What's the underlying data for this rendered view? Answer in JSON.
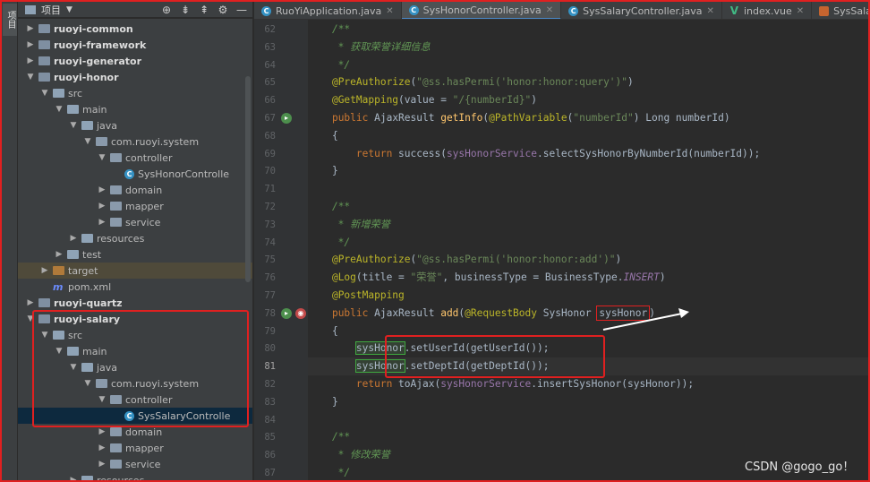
{
  "sidebar": {
    "vertical_tab": "项目"
  },
  "project_panel": {
    "header_label": "项目",
    "tree": [
      {
        "label": "ruoyi-common",
        "type": "module",
        "arrow": "▶",
        "indent": 1,
        "bold": true
      },
      {
        "label": "ruoyi-framework",
        "type": "module",
        "arrow": "▶",
        "indent": 1,
        "bold": true
      },
      {
        "label": "ruoyi-generator",
        "type": "module",
        "arrow": "▶",
        "indent": 1,
        "bold": true
      },
      {
        "label": "ruoyi-honor",
        "type": "module",
        "arrow": "▼",
        "indent": 1,
        "bold": true
      },
      {
        "label": "src",
        "type": "folder",
        "arrow": "▼",
        "indent": 2
      },
      {
        "label": "main",
        "type": "folder",
        "arrow": "▼",
        "indent": 3
      },
      {
        "label": "java",
        "type": "folder",
        "arrow": "▼",
        "indent": 4
      },
      {
        "label": "com.ruoyi.system",
        "type": "package",
        "arrow": "▼",
        "indent": 5
      },
      {
        "label": "controller",
        "type": "package",
        "arrow": "▼",
        "indent": 6
      },
      {
        "label": "SysHonorControlle",
        "type": "class",
        "arrow": "",
        "indent": 7
      },
      {
        "label": "domain",
        "type": "package",
        "arrow": "▶",
        "indent": 6
      },
      {
        "label": "mapper",
        "type": "package",
        "arrow": "▶",
        "indent": 6
      },
      {
        "label": "service",
        "type": "package",
        "arrow": "▶",
        "indent": 6
      },
      {
        "label": "resources",
        "type": "folder",
        "arrow": "▶",
        "indent": 4
      },
      {
        "label": "test",
        "type": "folder",
        "arrow": "▶",
        "indent": 3
      },
      {
        "label": "target",
        "type": "target",
        "arrow": "▶",
        "indent": 2,
        "excluded": true
      },
      {
        "label": "pom.xml",
        "type": "maven",
        "arrow": "",
        "indent": 2
      },
      {
        "label": "ruoyi-quartz",
        "type": "module",
        "arrow": "▶",
        "indent": 1,
        "bold": true
      },
      {
        "label": "ruoyi-salary",
        "type": "module",
        "arrow": "▼",
        "indent": 1,
        "bold": true
      },
      {
        "label": "src",
        "type": "folder",
        "arrow": "▼",
        "indent": 2
      },
      {
        "label": "main",
        "type": "folder",
        "arrow": "▼",
        "indent": 3
      },
      {
        "label": "java",
        "type": "folder",
        "arrow": "▼",
        "indent": 4
      },
      {
        "label": "com.ruoyi.system",
        "type": "package",
        "arrow": "▼",
        "indent": 5
      },
      {
        "label": "controller",
        "type": "package",
        "arrow": "▼",
        "indent": 6
      },
      {
        "label": "SysSalaryControlle",
        "type": "class",
        "arrow": "",
        "indent": 7,
        "selected": true
      },
      {
        "label": "domain",
        "type": "package",
        "arrow": "▶",
        "indent": 6
      },
      {
        "label": "mapper",
        "type": "package",
        "arrow": "▶",
        "indent": 6
      },
      {
        "label": "service",
        "type": "package",
        "arrow": "▶",
        "indent": 6
      },
      {
        "label": "resources",
        "type": "folder",
        "arrow": "▶",
        "indent": 4
      }
    ]
  },
  "tabs": [
    {
      "label": "RuoYiApplication.java",
      "icon": "class-icon",
      "active": false
    },
    {
      "label": "SysHonorController.java",
      "icon": "class-icon",
      "active": true
    },
    {
      "label": "SysSalaryController.java",
      "icon": "class-icon",
      "active": false
    },
    {
      "label": "index.vue",
      "icon": "vue-icon",
      "active": false
    },
    {
      "label": "SysSalaryMap",
      "icon": "xml-icon",
      "active": false
    }
  ],
  "editor": {
    "current_line": 81,
    "lines": [
      {
        "n": 62,
        "html": "    <span class='c-com'>/**</span>"
      },
      {
        "n": 63,
        "html": "<span class='c-com'>     * 获取荣誉详细信息</span>"
      },
      {
        "n": 64,
        "html": "<span class='c-com'>     */</span>"
      },
      {
        "n": 65,
        "html": "    <span class='c-ann'>@PreAuthorize</span>(<span class='c-str'>\"@ss.hasPermi('honor:honor:query')\"</span>)"
      },
      {
        "n": 66,
        "html": "    <span class='c-ann'>@GetMapping</span>(value = <span class='c-str'>\"/{numberId}\"</span>)"
      },
      {
        "n": 67,
        "html": "    <span class='c-kw'>public</span> AjaxResult <span class='c-fn'>getInfo</span>(<span class='c-ann'>@PathVariable</span>(<span class='c-str'>\"numberId\"</span>) Long numberId)",
        "gutter": "run"
      },
      {
        "n": 68,
        "html": "    {"
      },
      {
        "n": 69,
        "html": "        <span class='c-kw'>return</span> success(<span class='c-mem'>sysHonorService</span>.selectSysHonorByNumberId(numberId));"
      },
      {
        "n": 70,
        "html": "    }"
      },
      {
        "n": 71,
        "html": ""
      },
      {
        "n": 72,
        "html": "    <span class='c-com'>/**</span>"
      },
      {
        "n": 73,
        "html": "<span class='c-com'>     * 新增荣誉</span>"
      },
      {
        "n": 74,
        "html": "<span class='c-com'>     */</span>"
      },
      {
        "n": 75,
        "html": "    <span class='c-ann'>@PreAuthorize</span>(<span class='c-str'>\"@ss.hasPermi('honor:honor:add')\"</span>)"
      },
      {
        "n": 76,
        "html": "    <span class='c-ann'>@Log</span>(title = <span class='c-str'>\"荣誉\"</span>, businessType = BusinessType.<span class='c-it'>INSERT</span>)"
      },
      {
        "n": 77,
        "html": "    <span class='c-ann'>@PostMapping</span>"
      },
      {
        "n": 78,
        "html": "    <span class='c-kw'>public</span> AjaxResult <span class='c-fn'>add</span>(<span class='c-ann'>@RequestBody</span> SysHonor <span class='hl-red'>sysHonor</span>)",
        "gutter": "run2"
      },
      {
        "n": 79,
        "html": "    {"
      },
      {
        "n": 80,
        "html": "        <span class='hl-green'>sysHonor</span>.setUserId(getUserId());"
      },
      {
        "n": 81,
        "html": "        <span class='hl-green'>sysHonor</span>.setDeptId(getDeptId());"
      },
      {
        "n": 82,
        "html": "        <span class='c-kw'>return</span> toAjax(<span class='c-mem'>sysHonorService</span>.insertSysHonor(sysHonor));"
      },
      {
        "n": 83,
        "html": "    }"
      },
      {
        "n": 84,
        "html": ""
      },
      {
        "n": 85,
        "html": "    <span class='c-com'>/**</span>"
      },
      {
        "n": 86,
        "html": "<span class='c-com'>     * 修改荣誉</span>"
      },
      {
        "n": 87,
        "html": "<span class='c-com'>     */</span>"
      }
    ]
  },
  "watermark": "CSDN @gogo_go！",
  "colors": {
    "annotation_red": "#e02020",
    "selection": "#0d293e",
    "highlight_green": "#3fa83f"
  }
}
